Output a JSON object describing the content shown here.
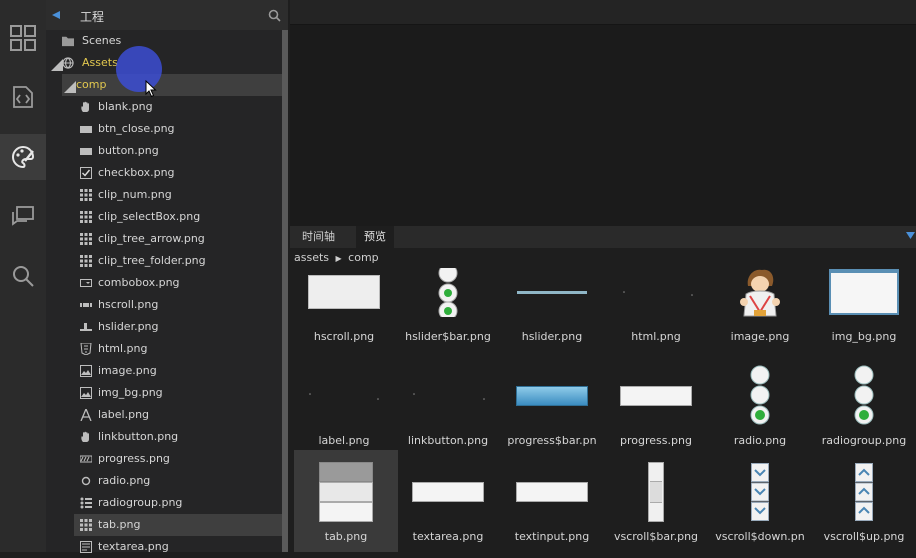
{
  "project": {
    "title": "工程",
    "search_icon": "search-icon",
    "tree": {
      "scenes": "Scenes",
      "assets": "Assets",
      "comp": "comp",
      "files": [
        "blank.png",
        "btn_close.png",
        "button.png",
        "checkbox.png",
        "clip_num.png",
        "clip_selectBox.png",
        "clip_tree_arrow.png",
        "clip_tree_folder.png",
        "combobox.png",
        "hscroll.png",
        "hslider.png",
        "html.png",
        "image.png",
        "img_bg.png",
        "label.png",
        "linkbutton.png",
        "progress.png",
        "radio.png",
        "radiogroup.png",
        "tab.png",
        "textarea.png"
      ],
      "selected": "tab.png"
    }
  },
  "panel": {
    "tabs": [
      "时间轴",
      "预览"
    ],
    "active_tab": "预览",
    "breadcrumb": {
      "root": "assets",
      "separator": "▶",
      "current": "comp"
    }
  },
  "grid": {
    "items": [
      "hscroll.png",
      "hslider$bar.png",
      "hslider.png",
      "html.png",
      "image.png",
      "img_bg.png",
      "label.png",
      "linkbutton.png",
      "progress$bar.pn",
      "progress.png",
      "radio.png",
      "radiogroup.png",
      "tab.png",
      "textarea.png",
      "textinput.png",
      "vscroll$bar.png",
      "vscroll$down.pn",
      "vscroll$up.png"
    ],
    "selected": "tab.png"
  },
  "colors": {
    "accent_highlight": "#3c4ed4",
    "assets_label": "#e2c84f",
    "progress_bar": "#4f9fcf",
    "radio_green": "#2fae3b"
  }
}
